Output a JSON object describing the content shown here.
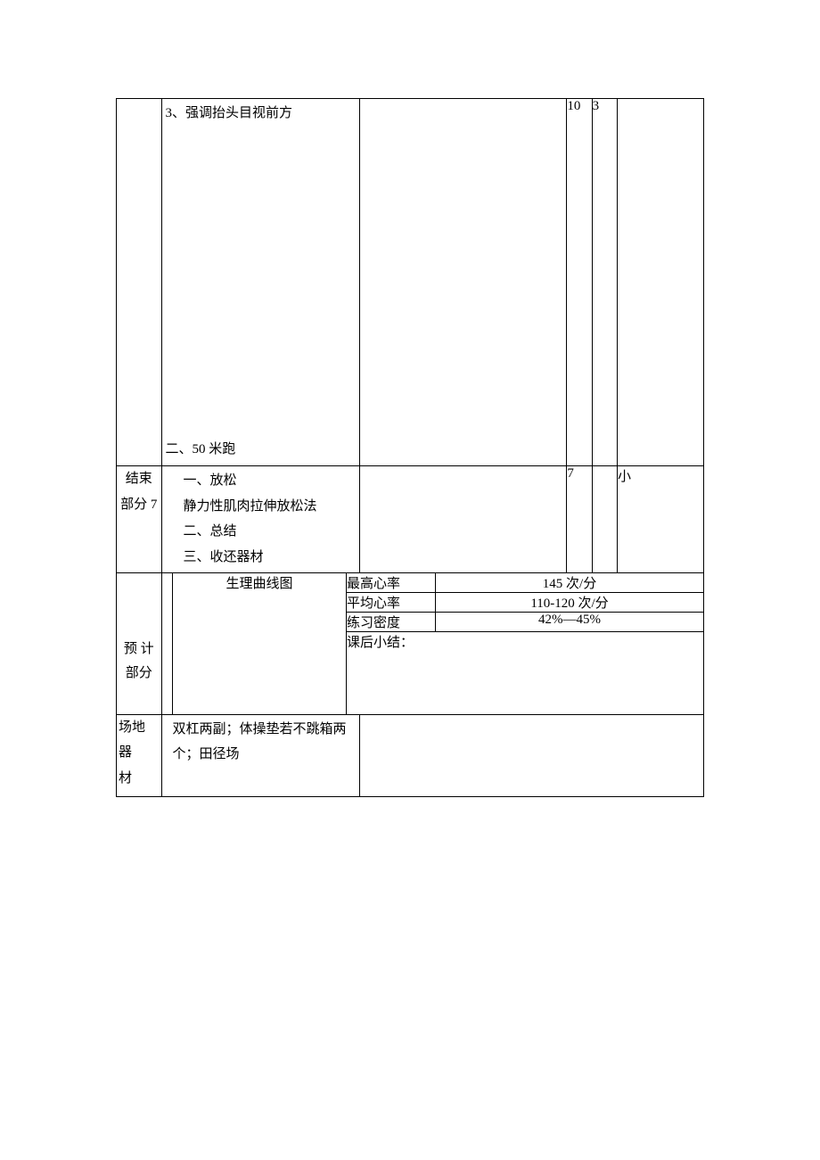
{
  "row1": {
    "content_line1": "3、强调抬头目视前方",
    "content_line2": "二、50 米跑",
    "num1": "10",
    "num2": "3"
  },
  "row_end": {
    "section_line1": "结束",
    "section_line2": "部分 7",
    "content_l1": "一、放松",
    "content_l2": "静力性肌肉拉伸放松法",
    "content_l3": "二、总结",
    "content_l4": "三、收还器材",
    "num1": "7",
    "last": "小"
  },
  "estimate": {
    "section_l1": "预  计",
    "section_l2": "部分",
    "curve_label": "生理曲线图",
    "metrics": {
      "max_hr_label": "最高心率",
      "max_hr_val": "145 次/分",
      "avg_hr_label": "平均心率",
      "avg_hr_val": "110-120 次/分",
      "density_label": "练习密度",
      "density_val": "42%—45%",
      "summary_label": "课后小结："
    }
  },
  "equipment": {
    "section_l1": "场地",
    "section_l2": "器",
    "section_l3": "材",
    "content": "双杠两副；体操垫若不跳箱两个；田径场"
  }
}
